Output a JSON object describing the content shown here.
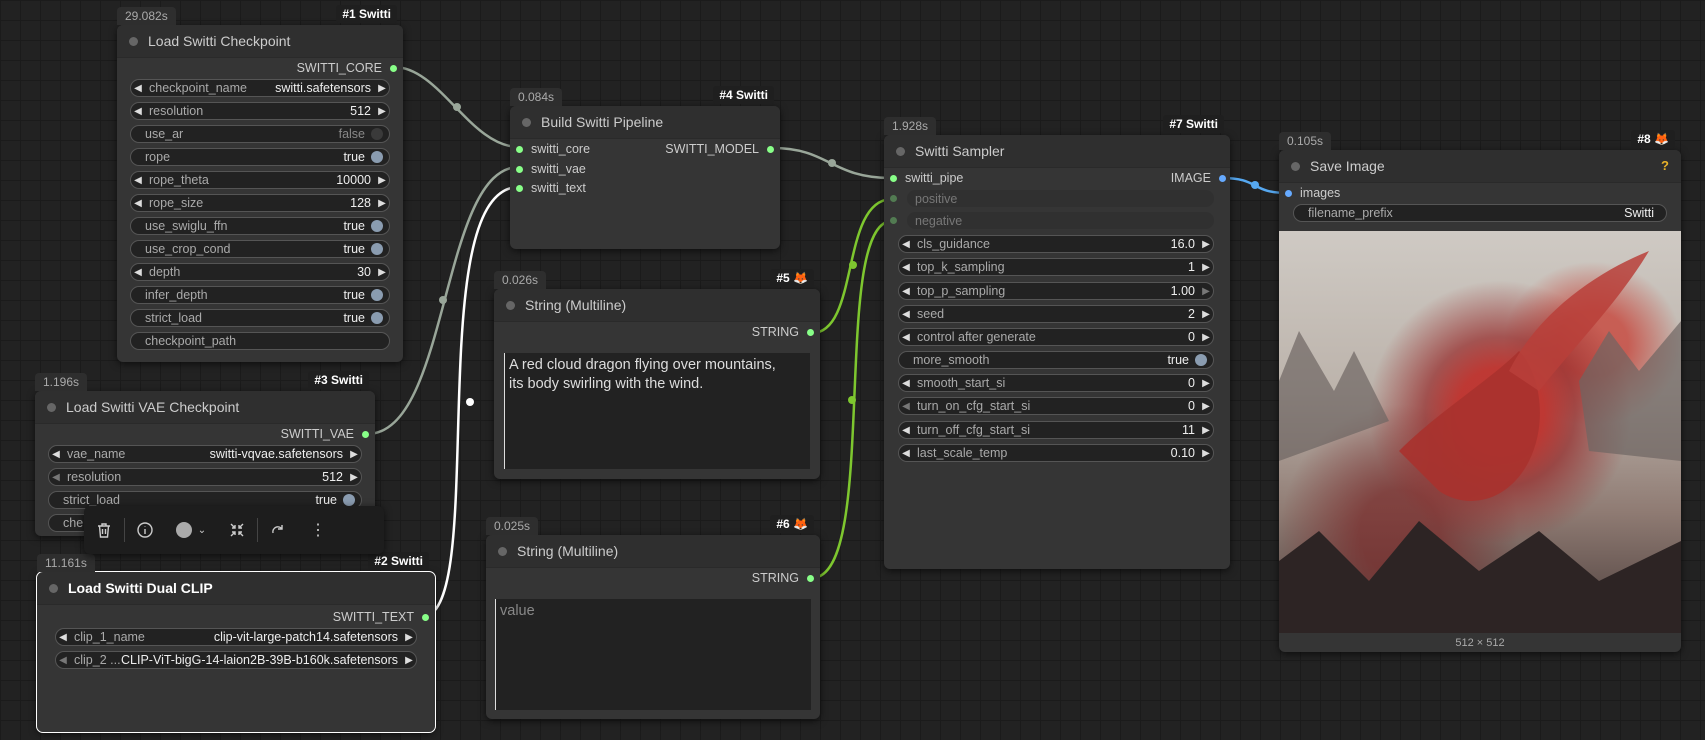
{
  "colors": {
    "wire": "#99a699",
    "wire_green": "#7ec72f",
    "wire_white": "#ffffff",
    "wire_blue": "#56a8f0"
  },
  "toolbar": {
    "delete_icon": "trash-icon",
    "info_icon": "info-icon",
    "color_icon": "color-dot-icon",
    "collapse_icon": "collapse-icon",
    "bypass_icon": "redo-icon",
    "more_icon": "more-vertical-icon"
  },
  "nodes": {
    "load_checkpoint": {
      "time": "29.082s",
      "id": "#1 Switti",
      "title": "Load Switti Checkpoint",
      "output": "SWITTI_CORE",
      "widgets": {
        "checkpoint_name": {
          "label": "checkpoint_name",
          "value": "switti.safetensors"
        },
        "resolution": {
          "label": "resolution",
          "value": "512"
        },
        "use_ar": {
          "label": "use_ar",
          "value": "false"
        },
        "rope": {
          "label": "rope",
          "value": "true"
        },
        "rope_theta": {
          "label": "rope_theta",
          "value": "10000"
        },
        "rope_size": {
          "label": "rope_size",
          "value": "128"
        },
        "use_swiglu_ffn": {
          "label": "use_swiglu_ffn",
          "value": "true"
        },
        "use_crop_cond": {
          "label": "use_crop_cond",
          "value": "true"
        },
        "depth": {
          "label": "depth",
          "value": "30"
        },
        "infer_depth": {
          "label": "infer_depth",
          "value": "true"
        },
        "strict_load": {
          "label": "strict_load",
          "value": "true"
        },
        "checkpoint_path": {
          "label": "checkpoint_path"
        }
      }
    },
    "vae_checkpoint": {
      "time": "1.196s",
      "id": "#3 Switti",
      "title": "Load Switti VAE Checkpoint",
      "output": "SWITTI_VAE",
      "widgets": {
        "vae_name": {
          "label": "vae_name",
          "value": "switti-vqvae.safetensors"
        },
        "resolution": {
          "label": "resolution",
          "value": "512"
        },
        "strict_load": {
          "label": "strict_load",
          "value": "true"
        },
        "partial": "che"
      }
    },
    "dual_clip": {
      "time": "11.161s",
      "id": "#2 Switti",
      "title": "Load Switti Dual CLIP",
      "output": "SWITTI_TEXT",
      "widgets": {
        "clip_1": {
          "label": "clip_1_name",
          "value": "clip-vit-large-patch14.safetensors"
        },
        "clip_2": {
          "label": "clip_2 ...",
          "value": "CLIP-ViT-bigG-14-laion2B-39B-b160k.safetensors"
        }
      }
    },
    "build_pipeline": {
      "time": "0.084s",
      "id": "#4 Switti",
      "title": "Build Switti Pipeline",
      "inputs": {
        "core": "switti_core",
        "vae": "switti_vae",
        "text": "switti_text"
      },
      "output": "SWITTI_MODEL"
    },
    "string_pos": {
      "time": "0.026s",
      "id": "#5",
      "title": "String (Multiline)",
      "output": "STRING",
      "text": "A red cloud dragon flying over mountains,\nits body swirling with the wind."
    },
    "string_neg": {
      "time": "0.025s",
      "id": "#6",
      "title": "String (Multiline)",
      "output": "STRING",
      "placeholder": "value"
    },
    "sampler": {
      "time": "1.928s",
      "id": "#7 Switti",
      "title": "Switti Sampler",
      "inputs": {
        "pipe": "switti_pipe",
        "positive": "positive",
        "negative": "negative"
      },
      "output": "IMAGE",
      "widgets": {
        "cls_guidance": {
          "label": "cls_guidance",
          "value": "16.0"
        },
        "top_k_sampling": {
          "label": "top_k_sampling",
          "value": "1"
        },
        "top_p_sampling": {
          "label": "top_p_sampling",
          "value": "1.00"
        },
        "seed": {
          "label": "seed",
          "value": "2"
        },
        "control_after_generate": {
          "label": "control after generate",
          "value": "0"
        },
        "more_smooth": {
          "label": "more_smooth",
          "value": "true"
        },
        "smooth_start_si": {
          "label": "smooth_start_si",
          "value": "0"
        },
        "turn_on_cfg_start_si": {
          "label": "turn_on_cfg_start_si",
          "value": "0"
        },
        "turn_off_cfg_start_si": {
          "label": "turn_off_cfg_start_si",
          "value": "11"
        },
        "last_scale_temp": {
          "label": "last_scale_temp",
          "value": "0.10"
        }
      }
    },
    "save_image": {
      "time": "0.105s",
      "id": "#8",
      "title": "Save Image",
      "input": "images",
      "widgets": {
        "filename_prefix": {
          "label": "filename_prefix",
          "value": "Switti"
        }
      },
      "image_size": "512 × 512"
    }
  }
}
